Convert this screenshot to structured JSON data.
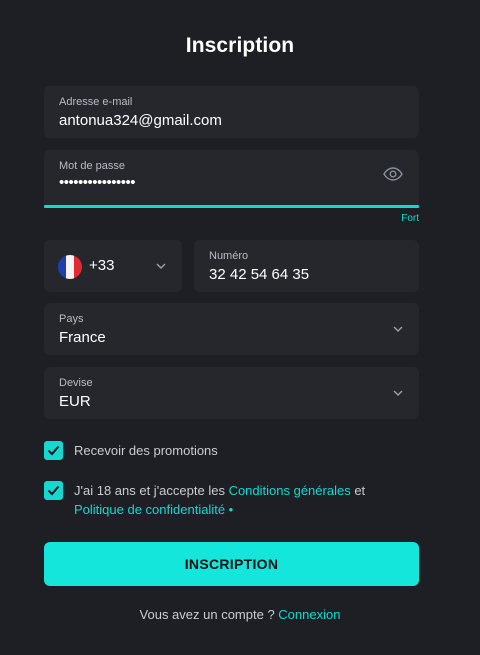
{
  "title": "Inscription",
  "email": {
    "label": "Adresse e-mail",
    "value": "antonua324@gmail.com"
  },
  "password": {
    "label": "Mot de passe",
    "value": "••••••••••••••••",
    "strength": "Fort"
  },
  "phone": {
    "dial_code": "+33",
    "label": "Numéro",
    "value": "32 42 54 64 35"
  },
  "country": {
    "label": "Pays",
    "value": "France"
  },
  "currency": {
    "label": "Devise",
    "value": "EUR"
  },
  "promotions": {
    "label": "Recevoir des promotions",
    "checked": true
  },
  "terms": {
    "prefix": "J'ai 18 ans et j'accepte les ",
    "conditions_link": "Conditions générales",
    "middle": " et",
    "privacy_link": "Politique de confidentialité",
    "required_mark": " •",
    "checked": true
  },
  "submit_label": "INSCRIPTION",
  "footer": {
    "text": "Vous avez un compte ? ",
    "link": "Connexion"
  },
  "colors": {
    "accent": "#14d9d0",
    "background": "#1d1f24",
    "field": "#25272d"
  }
}
